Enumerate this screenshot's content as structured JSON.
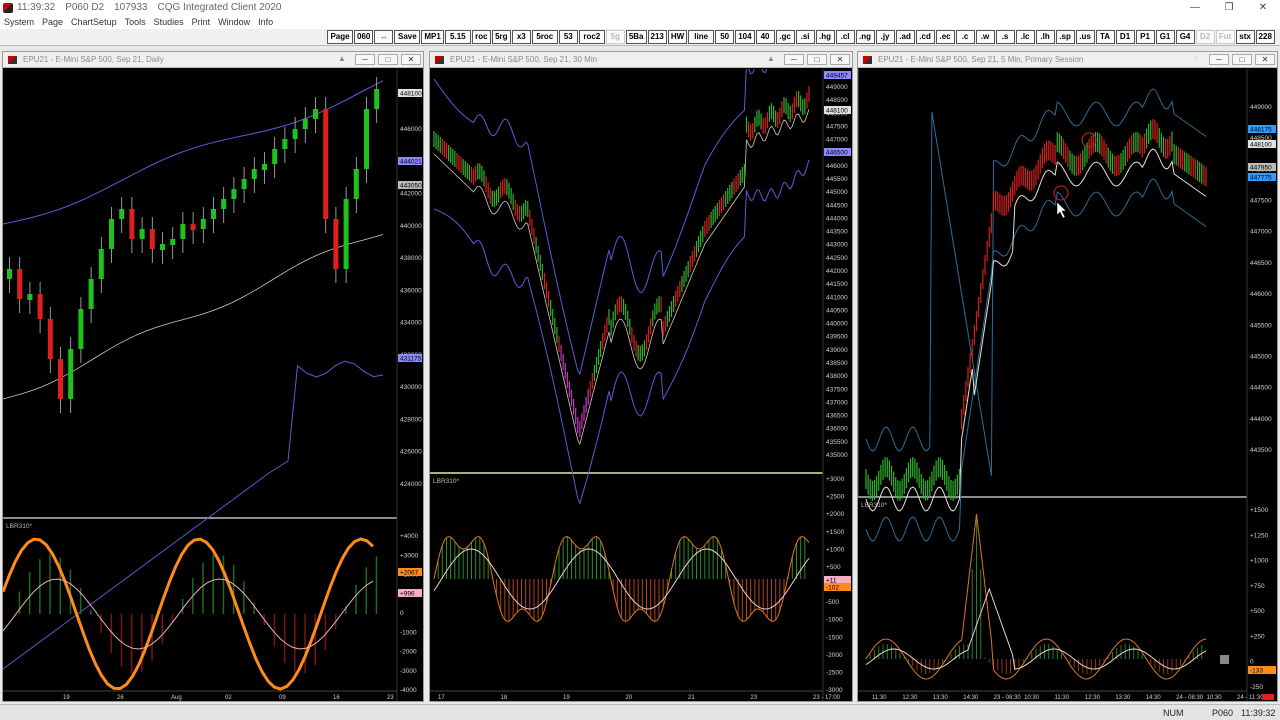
{
  "titlebar": {
    "time": "11:39:32",
    "page": "P060 D2",
    "account": "107933",
    "app_name": "CQG Integrated Client 2020",
    "minimize": "—",
    "restore": "❐",
    "close": "✕"
  },
  "menu": [
    "System",
    "Page",
    "ChartSetup",
    "Tools",
    "Studies",
    "Print",
    "Window",
    "Info"
  ],
  "toolbar": [
    {
      "label": "Page",
      "state": "normal"
    },
    {
      "label": "060",
      "state": "normal"
    },
    {
      "label": "↔",
      "state": "red"
    },
    {
      "label": "Save",
      "state": "normal"
    },
    {
      "label": "MP1",
      "state": "normal"
    },
    {
      "label": "5.15",
      "state": "normal"
    },
    {
      "label": "roc",
      "state": "normal"
    },
    {
      "label": "5rg",
      "state": "normal"
    },
    {
      "label": "x3",
      "state": "normal"
    },
    {
      "label": "5roc",
      "state": "normal"
    },
    {
      "label": "53",
      "state": "normal"
    },
    {
      "label": "roc2",
      "state": "normal"
    },
    {
      "label": "5g",
      "state": "dim"
    },
    {
      "label": "5Ba",
      "state": "normal"
    },
    {
      "label": "213",
      "state": "normal"
    },
    {
      "label": "HW",
      "state": "normal"
    },
    {
      "label": "line",
      "state": "normal"
    },
    {
      "label": "50",
      "state": "normal"
    },
    {
      "label": "104",
      "state": "normal"
    },
    {
      "label": "40",
      "state": "normal"
    },
    {
      "label": ".gc",
      "state": "normal"
    },
    {
      "label": ".si",
      "state": "normal"
    },
    {
      "label": ".hg",
      "state": "normal"
    },
    {
      "label": ".cl",
      "state": "normal"
    },
    {
      "label": ".ng",
      "state": "normal"
    },
    {
      "label": ".jy",
      "state": "normal"
    },
    {
      "label": ".ad",
      "state": "normal"
    },
    {
      "label": ".cd",
      "state": "normal"
    },
    {
      "label": ".ec",
      "state": "normal"
    },
    {
      "label": ".c",
      "state": "normal"
    },
    {
      "label": ".w",
      "state": "normal"
    },
    {
      "label": ".s",
      "state": "normal"
    },
    {
      "label": ".lc",
      "state": "normal"
    },
    {
      "label": ".lh",
      "state": "normal"
    },
    {
      "label": ".sp",
      "state": "normal"
    },
    {
      "label": ".us",
      "state": "normal"
    },
    {
      "label": "TA",
      "state": "normal"
    },
    {
      "label": "D1",
      "state": "normal"
    },
    {
      "label": "P1",
      "state": "normal"
    },
    {
      "label": "G1",
      "state": "normal"
    },
    {
      "label": "G4",
      "state": "normal"
    },
    {
      "label": "D2",
      "state": "dim"
    },
    {
      "label": "Fut",
      "state": "dim"
    },
    {
      "label": "stx",
      "state": "normal"
    },
    {
      "label": "228",
      "state": "normal"
    }
  ],
  "windows": [
    {
      "title": "EPU21 - E-Mini S&P 500, Sep 21, Daily",
      "price_labels": [
        "446000",
        "444000",
        "442000",
        "440000",
        "438000",
        "436000",
        "434000",
        "432000",
        "430000",
        "428000",
        "426000",
        "424000"
      ],
      "osc_label": "LBR310*",
      "osc_labels": [
        "+4000",
        "+3000",
        "+2000",
        "+1000",
        "0",
        "-1000",
        "-2000",
        "-3000",
        "-4000"
      ],
      "date_labels": [
        "19",
        "26",
        "Aug",
        "02",
        "09",
        "16",
        "23"
      ],
      "price_tags": [
        {
          "value": "448100",
          "color": "#ffffff"
        },
        {
          "value": "444021",
          "color": "#8a8aff"
        },
        {
          "value": "443050",
          "color": "#bbbbbb"
        },
        {
          "value": "431175",
          "color": "#8a8aff"
        }
      ],
      "osc_tags": [
        {
          "value": "+2067",
          "color": "#ff8c1a"
        },
        {
          "value": "+996",
          "color": "#f0b0c0"
        }
      ]
    },
    {
      "title": "EPU21 - E-Mini S&P 500, Sep 21, 30 Min",
      "price_labels": [
        "449000",
        "448500",
        "448000",
        "447500",
        "447000",
        "446500",
        "446000",
        "445500",
        "445000",
        "444500",
        "444000",
        "443500",
        "443000",
        "442500",
        "442000",
        "441500",
        "441000",
        "440500",
        "440000",
        "439500",
        "439000",
        "438500",
        "438000",
        "437500",
        "437000",
        "436500",
        "436000",
        "435500",
        "435000"
      ],
      "osc_label": "LBR310*",
      "osc_labels": [
        "+3000",
        "+2500",
        "+2000",
        "+1500",
        "+1000",
        "+500",
        "0",
        "-500",
        "-1000",
        "-1500",
        "-2000",
        "-2500",
        "-3000"
      ],
      "date_labels": [
        "17",
        "18",
        "19",
        "20",
        "21",
        "23",
        "23 - 17:00"
      ],
      "price_tags": [
        {
          "value": "449457",
          "color": "#8a8aff"
        },
        {
          "value": "448100",
          "color": "#ffffff"
        },
        {
          "value": "446500",
          "color": "#8a8aff"
        }
      ],
      "osc_tags": [
        {
          "value": "+11",
          "color": "#f0b0c0"
        },
        {
          "value": "-102",
          "color": "#ff8c1a"
        }
      ]
    },
    {
      "title": "EPU21 - E-Mini S&P 500, Sep 21, 5 Min, Primary Session",
      "price_labels": [
        "449000",
        "448500",
        "448000",
        "447500",
        "447000",
        "446500",
        "446000",
        "445500",
        "445000",
        "444500",
        "444000",
        "443500"
      ],
      "osc_label": "LBR310*",
      "osc_labels": [
        "+1500",
        "+1250",
        "+1000",
        "+750",
        "+500",
        "+250",
        "0",
        "-250"
      ],
      "date_labels": [
        "11:30",
        "12:30",
        "13:30",
        "14:30",
        "23 - 08:30",
        "10:30",
        "11:30",
        "12:30",
        "13:30",
        "14:30",
        "24 - 08:30",
        "10:30",
        "24 - 11:30"
      ],
      "price_tags": [
        {
          "value": "448175",
          "color": "#2f9cff"
        },
        {
          "value": "448100",
          "color": "#ffffff"
        },
        {
          "value": "447950",
          "color": "#bbbbbb"
        },
        {
          "value": "447775",
          "color": "#2f9cff"
        }
      ],
      "osc_tags": [
        {
          "value": "-133",
          "color": "#ff8c1a"
        }
      ]
    }
  ],
  "status": {
    "mode": "NUM",
    "page": "P060",
    "time": "11:39:32"
  }
}
